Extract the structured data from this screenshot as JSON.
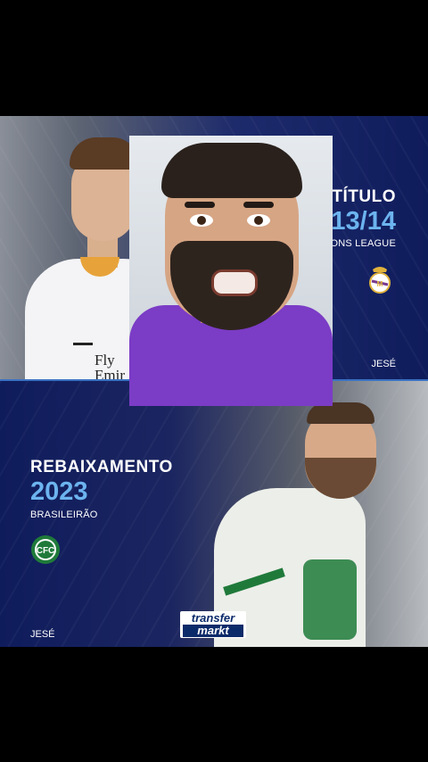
{
  "top": {
    "label": "TÍTULO",
    "year": "2013/14",
    "competition": "CHAMPIONS LEAGUE",
    "player_name": "JESÉ",
    "shirt_text": "Fly\nEmir",
    "crest": "real-madrid-crest"
  },
  "bottom": {
    "label": "REBAIXAMENTO",
    "year": "2023",
    "competition": "BRASILEIRÃO",
    "player_name": "JESÉ",
    "crest": "coritiba-crest",
    "crest_text": "CFC"
  },
  "logo": {
    "line1": "transfer",
    "line2": "markt"
  },
  "colors": {
    "accent_blue": "#6cb4ef",
    "panel_navy": "#0f1c5c",
    "divider": "#3a72c2",
    "facecam_shirt": "#7b3cc6"
  }
}
